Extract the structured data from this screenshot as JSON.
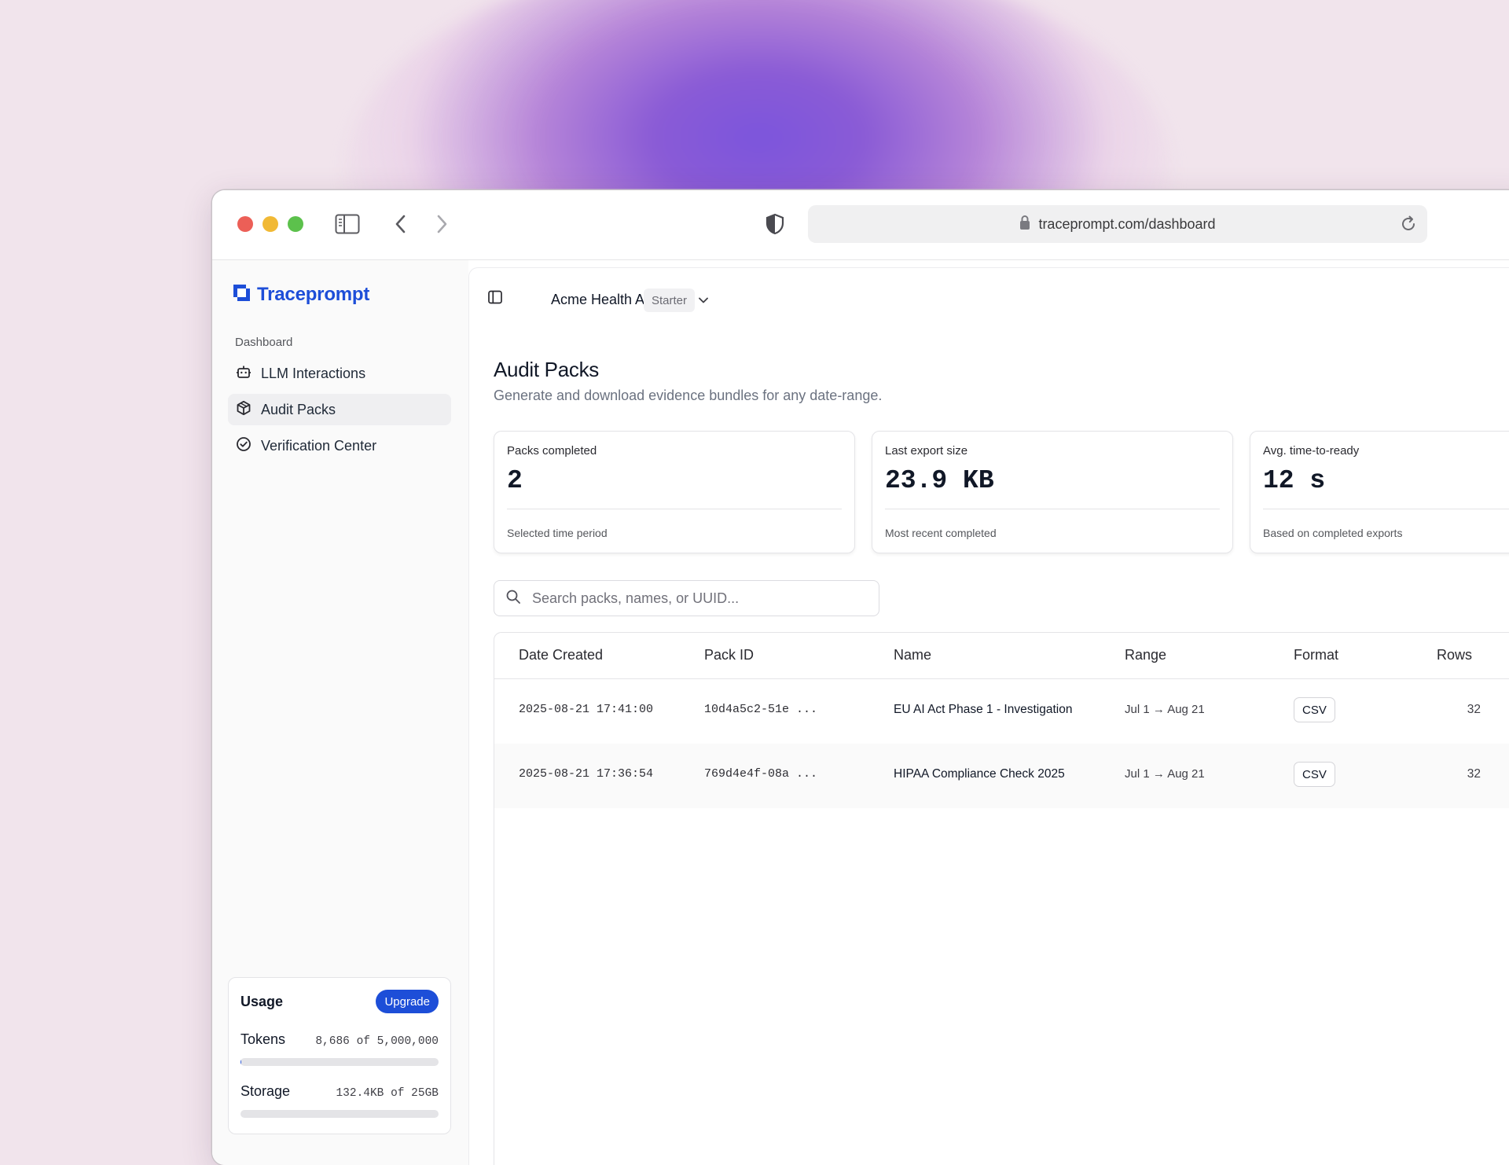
{
  "browser": {
    "url": "traceprompt.com/dashboard"
  },
  "sidebar": {
    "brand": "Traceprompt",
    "section_label": "Dashboard",
    "items": [
      {
        "label": "LLM Interactions",
        "icon": "bot-icon",
        "active": false
      },
      {
        "label": "Audit Packs",
        "icon": "package-icon",
        "active": true
      },
      {
        "label": "Verification Center",
        "icon": "check-circle-icon",
        "active": false
      }
    ],
    "usage": {
      "title": "Usage",
      "upgrade_label": "Upgrade",
      "tokens_label": "Tokens",
      "tokens_value": "8,686 of 5,000,000",
      "tokens_fraction": 0.0017,
      "storage_label": "Storage",
      "storage_value": "132.4KB of 25GB",
      "storage_fraction": 5.3e-06
    }
  },
  "topbar": {
    "org_name": "Acme Health AI",
    "plan": "Starter"
  },
  "page": {
    "title": "Audit Packs",
    "subtitle": "Generate and download evidence bundles for any date-range."
  },
  "stats": [
    {
      "label": "Packs completed",
      "value": "2",
      "footer": "Selected time period"
    },
    {
      "label": "Last export size",
      "value": "23.9 KB",
      "footer": "Most recent completed"
    },
    {
      "label": "Avg. time-to-ready",
      "value": "12 s",
      "footer": "Based on completed exports"
    }
  ],
  "search": {
    "placeholder": "Search packs, names, or UUID..."
  },
  "table": {
    "columns": [
      "Date Created",
      "Pack ID",
      "Name",
      "Range",
      "Format",
      "Rows"
    ],
    "rows": [
      {
        "date": "2025-08-21 17:41:00",
        "pack_id": "10d4a5c2-51e ...",
        "name": "EU AI Act Phase 1 - Investigation",
        "range": "Jul 1 → Aug 21",
        "format": "CSV",
        "rows": "32"
      },
      {
        "date": "2025-08-21 17:36:54",
        "pack_id": "769d4e4f-08a ...",
        "name": "HIPAA Compliance Check 2025",
        "range": "Jul 1 → Aug 21",
        "format": "CSV",
        "rows": "32"
      }
    ]
  },
  "colors": {
    "accent": "#1d4ed8",
    "background": "#f1e4ec",
    "glow": "#7c55dc"
  }
}
